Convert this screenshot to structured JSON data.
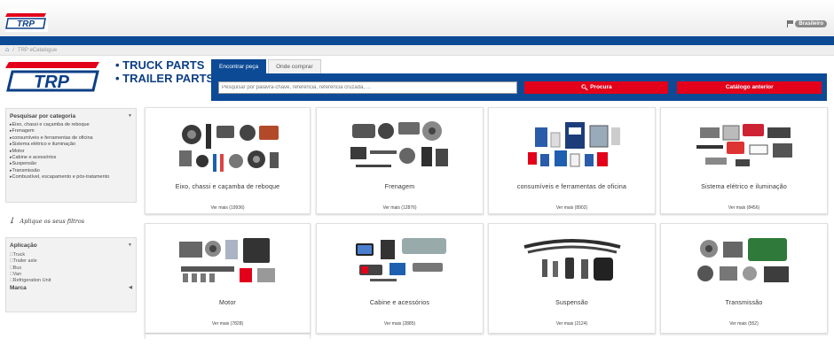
{
  "header": {
    "logo_text": "TRP",
    "language": "Brasileiro"
  },
  "breadcrumb": {
    "home_icon": "home-icon",
    "separator": "/",
    "current": "TRP eCatalogue"
  },
  "brand": {
    "logo_text": "TRP",
    "line1": "• TRUCK PARTS",
    "line2": "• TRAILER PARTS"
  },
  "search": {
    "tabs": [
      "Encontrar peça",
      "Onde comprar"
    ],
    "placeholder": "Pesquisar por palavra-chave, referência, referência cruzada, ...",
    "search_button": "Procura",
    "previous_catalog_button": "Catálogo anterior",
    "search_icon": "search-icon"
  },
  "sidebar": {
    "category_title": "Pesquisar por categoria",
    "categories": [
      "Eixo, chassi e caçamba de reboque",
      "Frenagem",
      "consumíveis e ferramentas de oficina",
      "Sistema elétrico e iluminação",
      "Motor",
      "Cabine e acessórios",
      "Suspensão",
      "Transmissão",
      "Combustível, escapamento e pós-tratamento"
    ],
    "filter_hint": "Aplique os seus filtros",
    "application_title": "Aplicação",
    "applications": [
      "Truck",
      "Trailer axle",
      "Bus",
      "Van",
      "Refrigeration Unit"
    ],
    "brand_title": "Marca"
  },
  "cards": [
    {
      "title": "Eixo, chassi e caçamba de reboque",
      "more": "Ver mais (19936)"
    },
    {
      "title": "Frenagem",
      "more": "Ver mais (12876)"
    },
    {
      "title": "consumíveis e ferramentas de oficina",
      "more": "Ver mais (8902)"
    },
    {
      "title": "Sistema elétrico e iluminação",
      "more": "Ver mais (8456)"
    },
    {
      "title": "Motor",
      "more": "Ver mais (7828)"
    },
    {
      "title": "Cabine e acessórios",
      "more": "Ver mais (2885)"
    },
    {
      "title": "Suspensão",
      "more": "Ver mais (2124)"
    },
    {
      "title": "Transmissão",
      "more": "Ver mais (552)"
    }
  ],
  "colors": {
    "brand_blue": "#0d4a96",
    "brand_red": "#e2001a"
  }
}
